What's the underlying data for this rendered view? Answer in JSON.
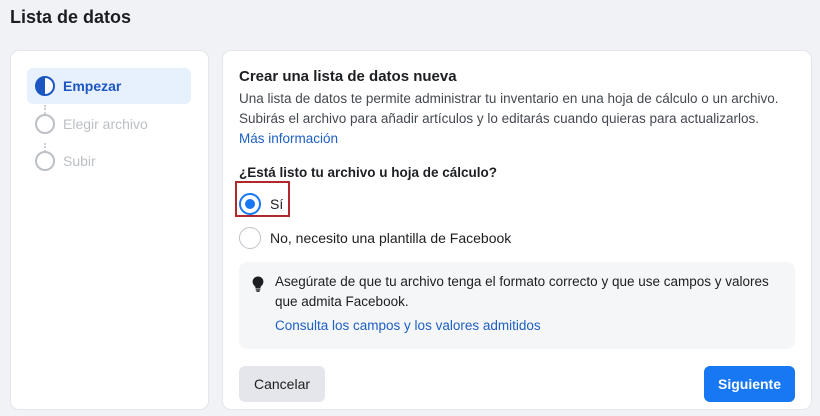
{
  "page": {
    "title": "Lista de datos"
  },
  "steps": [
    {
      "label": "Empezar",
      "state": "active"
    },
    {
      "label": "Elegir archivo",
      "state": "inactive"
    },
    {
      "label": "Subir",
      "state": "inactive"
    }
  ],
  "card": {
    "title": "Crear una lista de datos nueva",
    "description": "Una lista de datos te permite administrar tu inventario en una hoja de cálculo o un archivo. Subirás el archivo para añadir artículos y lo editarás cuando quieras para actualizarlos.",
    "more_info_link": "Más información",
    "question": "¿Está listo tu archivo u hoja de cálculo?",
    "options": [
      {
        "label": "Sí",
        "checked": true
      },
      {
        "label": "No, necesito una plantilla de Facebook",
        "checked": false
      }
    ],
    "tip": {
      "icon": "lightbulb-icon",
      "text": "Asegúrate de que tu archivo tenga el formato correcto y que use campos y valores que admita Facebook.",
      "link": "Consulta los campos y los valores admitidos"
    }
  },
  "buttons": {
    "cancel": "Cancelar",
    "next": "Siguiente"
  },
  "colors": {
    "accent": "#1877f2",
    "active_step": "#1c56c2",
    "link": "#1d5fc4",
    "highlight": "#b0282a"
  }
}
